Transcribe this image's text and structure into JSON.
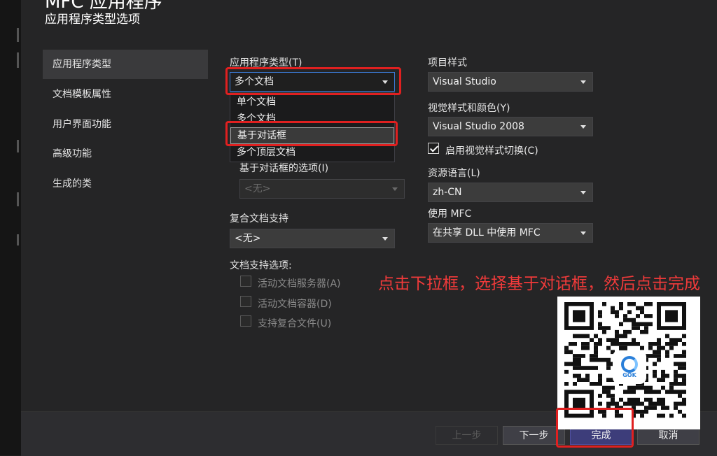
{
  "window": {
    "title": "MFC 应用程序",
    "subtitle": "应用程序类型选项"
  },
  "nav": {
    "items": [
      {
        "label": "应用程序类型",
        "active": true
      },
      {
        "label": "文档模板属性"
      },
      {
        "label": "用户界面功能"
      },
      {
        "label": "高级功能"
      },
      {
        "label": "生成的类"
      }
    ]
  },
  "app_type": {
    "label": "应用程序类型(T)",
    "value": "多个文档",
    "options": [
      "单个文档",
      "多个文档",
      "基于对话框",
      "多个顶层文档"
    ],
    "hovered": "基于对话框"
  },
  "dialog_options": {
    "label": "基于对话框的选项(I)",
    "value": "<无>"
  },
  "compound": {
    "label": "复合文档支持",
    "value": "<无>"
  },
  "doc_support": {
    "label": "文档支持选项:",
    "options": [
      "活动文档服务器(A)",
      "活动文档容器(D)",
      "支持复合文件(U)"
    ]
  },
  "project_style": {
    "label": "项目样式",
    "value": "Visual Studio"
  },
  "visual_style": {
    "label": "视觉样式和颜色(Y)",
    "value": "Visual Studio 2008"
  },
  "enable_visual_switch": {
    "label": "启用视觉样式切换(C)",
    "checked": true
  },
  "resource_lang": {
    "label": "资源语言(L)",
    "value": "zh-CN"
  },
  "use_mfc": {
    "label": "使用 MFC",
    "value": "在共享 DLL 中使用 MFC"
  },
  "annotation": "点击下拉框，选择基于对话框，然后点击完成",
  "buttons": {
    "prev": "上一步",
    "next": "下一步",
    "finish": "完成",
    "cancel": "取消"
  },
  "qr_logo_text": "GOK",
  "colors": {
    "highlight_red": "#e02020",
    "annotation_red": "#f03a3a",
    "accent_blue": "#3a7ad5"
  }
}
